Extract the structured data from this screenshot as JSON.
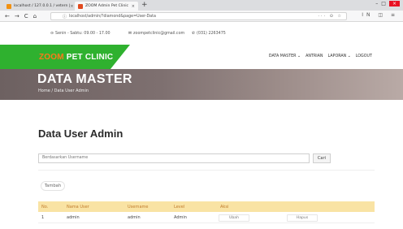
{
  "browser": {
    "tabs": [
      {
        "title": "localhost / 127.0.0.1 / vetern | ",
        "favicon_color": "#f29111"
      },
      {
        "title": "ZOOM Admin Pet Clinic",
        "favicon_color": "#e04a1f"
      }
    ],
    "new_tab": "+",
    "url": "localhost/admin/?diamond&page=User-Data",
    "nav_back": "←",
    "nav_forward": "→",
    "nav_reload": "C",
    "nav_home": "⌂",
    "url_icons": "··· ⊙ ☆",
    "right_icons": "IN ◫ ≡",
    "window_controls": [
      "–",
      "□",
      "×"
    ]
  },
  "topbar": {
    "hours": "Senin - Sabtu: 09.00 - 17.00",
    "email": "zoompetclinic@gmail.com",
    "phone": "(031) 2263475"
  },
  "header": {
    "brand_part1": "ZOOM",
    "brand_part2": "PET CLINIC",
    "brand_color": "#2fb12f",
    "brand_accent": "#ff7a1a",
    "menu": [
      "DATA MASTER ⌄",
      "ANTRIAN",
      "LAPORAN ⌄",
      "LOGOUT"
    ]
  },
  "hero": {
    "title": "DATA MASTER",
    "breadcrumb": "Home / Data User Admin"
  },
  "content": {
    "title": "Data User Admin",
    "search_placeholder": "Berdasarkan Username",
    "search_button": "Cari",
    "add_button": "Tambah",
    "table": {
      "headers": [
        "No.",
        "Nama User",
        "Username",
        "Level",
        "Aksi"
      ],
      "rows": [
        {
          "no": "1",
          "nama": "admin",
          "username": "admin",
          "level": "Admin",
          "ubah": "Ubah",
          "hapus": "Hapus"
        }
      ]
    }
  }
}
